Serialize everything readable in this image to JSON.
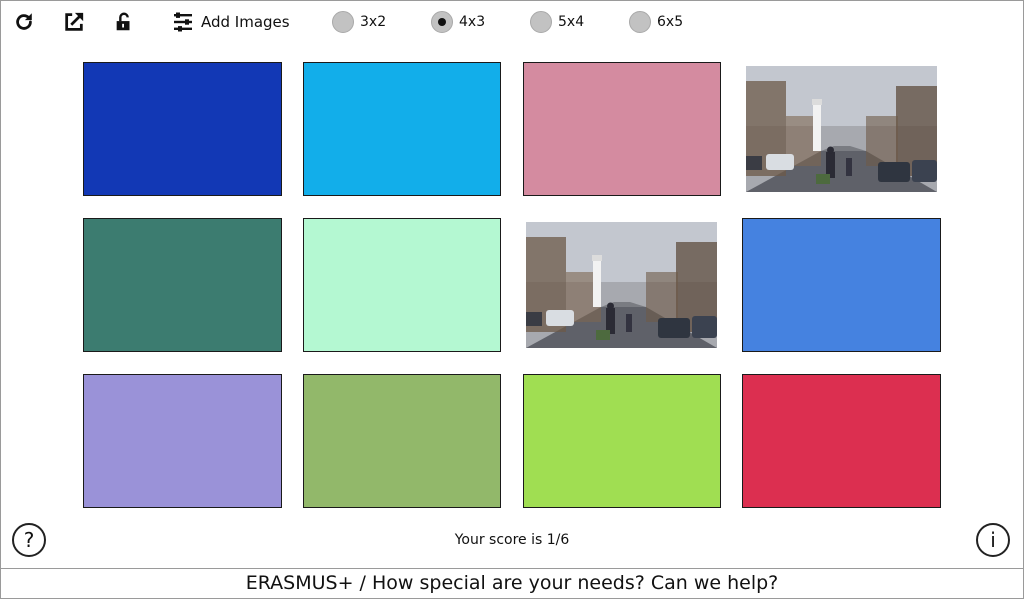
{
  "toolbar": {
    "add_images_label": "Add Images",
    "icons": [
      "refresh-icon",
      "open-external-icon",
      "unlock-icon",
      "sliders-icon"
    ],
    "grid_options": [
      {
        "label": "3x2",
        "selected": false
      },
      {
        "label": "4x3",
        "selected": true
      },
      {
        "label": "5x4",
        "selected": false
      },
      {
        "label": "6x5",
        "selected": false
      }
    ]
  },
  "board": {
    "cards": [
      {
        "type": "color",
        "color": "#1238b5"
      },
      {
        "type": "color",
        "color": "#12aeea"
      },
      {
        "type": "color",
        "color": "#d48ba0"
      },
      {
        "type": "photo",
        "subject": "lighthouse street"
      },
      {
        "type": "color",
        "color": "#3c7c70"
      },
      {
        "type": "color",
        "color": "#b4f8d2"
      },
      {
        "type": "photo",
        "subject": "lighthouse street"
      },
      {
        "type": "color",
        "color": "#4582e0"
      },
      {
        "type": "color",
        "color": "#9a92d8"
      },
      {
        "type": "color",
        "color": "#92b86a"
      },
      {
        "type": "color",
        "color": "#a0de52"
      },
      {
        "type": "color",
        "color": "#dc2f50"
      }
    ]
  },
  "score_text": "Your score is 1/6",
  "help_label": "?",
  "info_label": "i",
  "footer_text": "ERASMUS+ / How special are your needs? Can we help?"
}
